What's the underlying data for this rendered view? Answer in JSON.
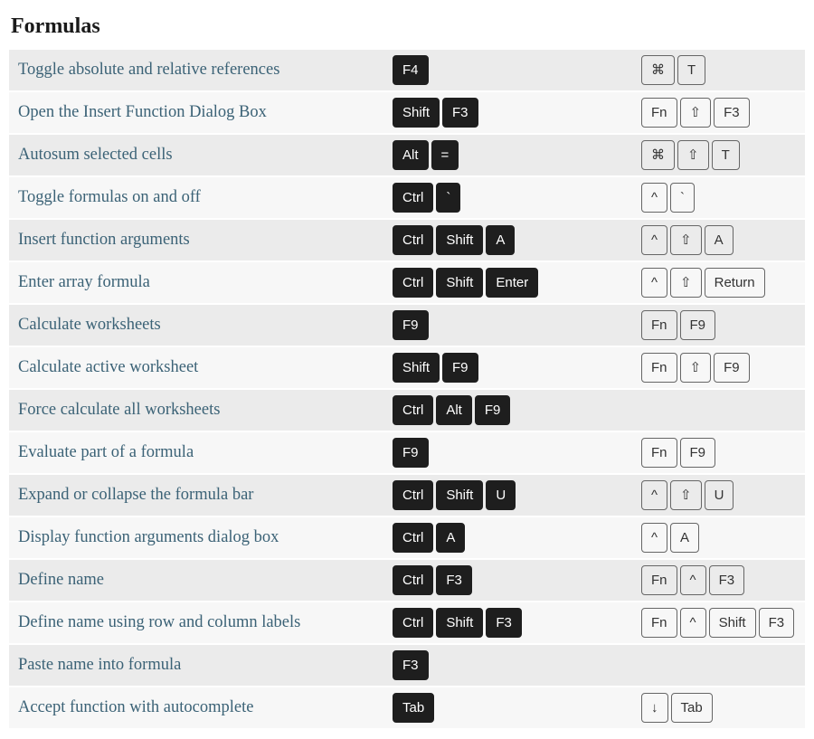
{
  "title": "Formulas",
  "rows": [
    {
      "desc": "Toggle absolute and relative references",
      "win": [
        "F4"
      ],
      "mac": [
        "⌘",
        "T"
      ]
    },
    {
      "desc": "Open the Insert Function Dialog Box",
      "win": [
        "Shift",
        "F3"
      ],
      "mac": [
        "Fn",
        "⇧",
        "F3"
      ]
    },
    {
      "desc": "Autosum selected cells",
      "win": [
        "Alt",
        "="
      ],
      "mac": [
        "⌘",
        "⇧",
        "T"
      ]
    },
    {
      "desc": "Toggle formulas on and off",
      "win": [
        "Ctrl",
        "`"
      ],
      "mac": [
        "^",
        "`"
      ]
    },
    {
      "desc": "Insert function arguments",
      "win": [
        "Ctrl",
        "Shift",
        "A"
      ],
      "mac": [
        "^",
        "⇧",
        "A"
      ]
    },
    {
      "desc": "Enter array formula",
      "win": [
        "Ctrl",
        "Shift",
        "Enter"
      ],
      "mac": [
        "^",
        "⇧",
        "Return"
      ]
    },
    {
      "desc": "Calculate worksheets",
      "win": [
        "F9"
      ],
      "mac": [
        "Fn",
        "F9"
      ]
    },
    {
      "desc": "Calculate active worksheet",
      "win": [
        "Shift",
        "F9"
      ],
      "mac": [
        "Fn",
        "⇧",
        "F9"
      ]
    },
    {
      "desc": "Force calculate all worksheets",
      "win": [
        "Ctrl",
        "Alt",
        "F9"
      ],
      "mac": []
    },
    {
      "desc": "Evaluate part of a formula",
      "win": [
        "F9"
      ],
      "mac": [
        "Fn",
        "F9"
      ]
    },
    {
      "desc": "Expand or collapse the formula bar",
      "win": [
        "Ctrl",
        "Shift",
        "U"
      ],
      "mac": [
        "^",
        "⇧",
        "U"
      ]
    },
    {
      "desc": "Display function arguments dialog box",
      "win": [
        "Ctrl",
        "A"
      ],
      "mac": [
        "^",
        "A"
      ]
    },
    {
      "desc": "Define name",
      "win": [
        "Ctrl",
        "F3"
      ],
      "mac": [
        "Fn",
        "^",
        "F3"
      ]
    },
    {
      "desc": "Define name using row and column labels",
      "win": [
        "Ctrl",
        "Shift",
        "F3"
      ],
      "mac": [
        "Fn",
        "^",
        "Shift",
        "F3"
      ]
    },
    {
      "desc": "Paste name into formula",
      "win": [
        "F3"
      ],
      "mac": []
    },
    {
      "desc": "Accept function with autocomplete",
      "win": [
        "Tab"
      ],
      "mac": [
        "↓",
        "Tab"
      ]
    }
  ]
}
